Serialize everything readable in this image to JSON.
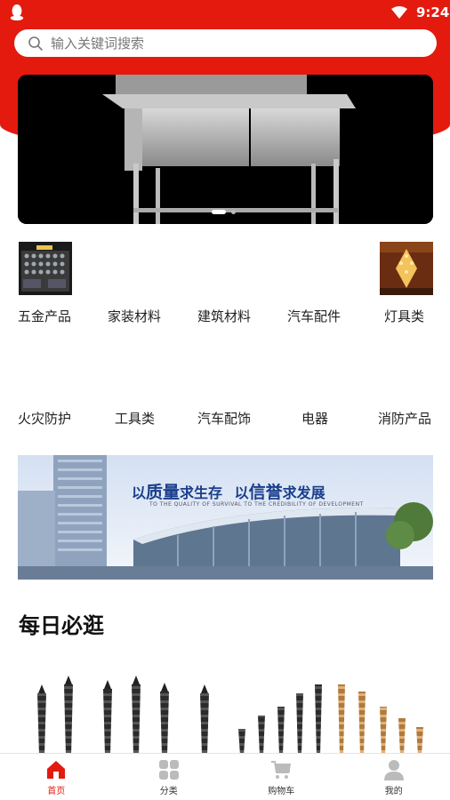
{
  "status_bar": {
    "time": "9:24"
  },
  "search": {
    "placeholder": "输入关键词搜索"
  },
  "categories_row1": [
    "五金产品",
    "家装材料",
    "建筑材料",
    "汽车配件",
    "灯具类"
  ],
  "categories_row2": [
    "火灾防护",
    "工具类",
    "汽车配饰",
    "电器",
    "消防产品"
  ],
  "promo": {
    "headline_part1": "以",
    "headline_part2": "质量",
    "headline_part3": "求生存",
    "headline_part4": "以",
    "headline_part5": "信誉",
    "headline_part6": "求发展",
    "subtitle": "TO THE QUALITY OF SURVIVAL TO THE CREDIBILITY OF DEVELOPMENT"
  },
  "section": {
    "title": "每日必逛"
  },
  "tabbar": {
    "home": "首页",
    "category": "分类",
    "cart": "购物车",
    "mine": "我的"
  },
  "colors": {
    "brand_red": "#e41a0e"
  }
}
